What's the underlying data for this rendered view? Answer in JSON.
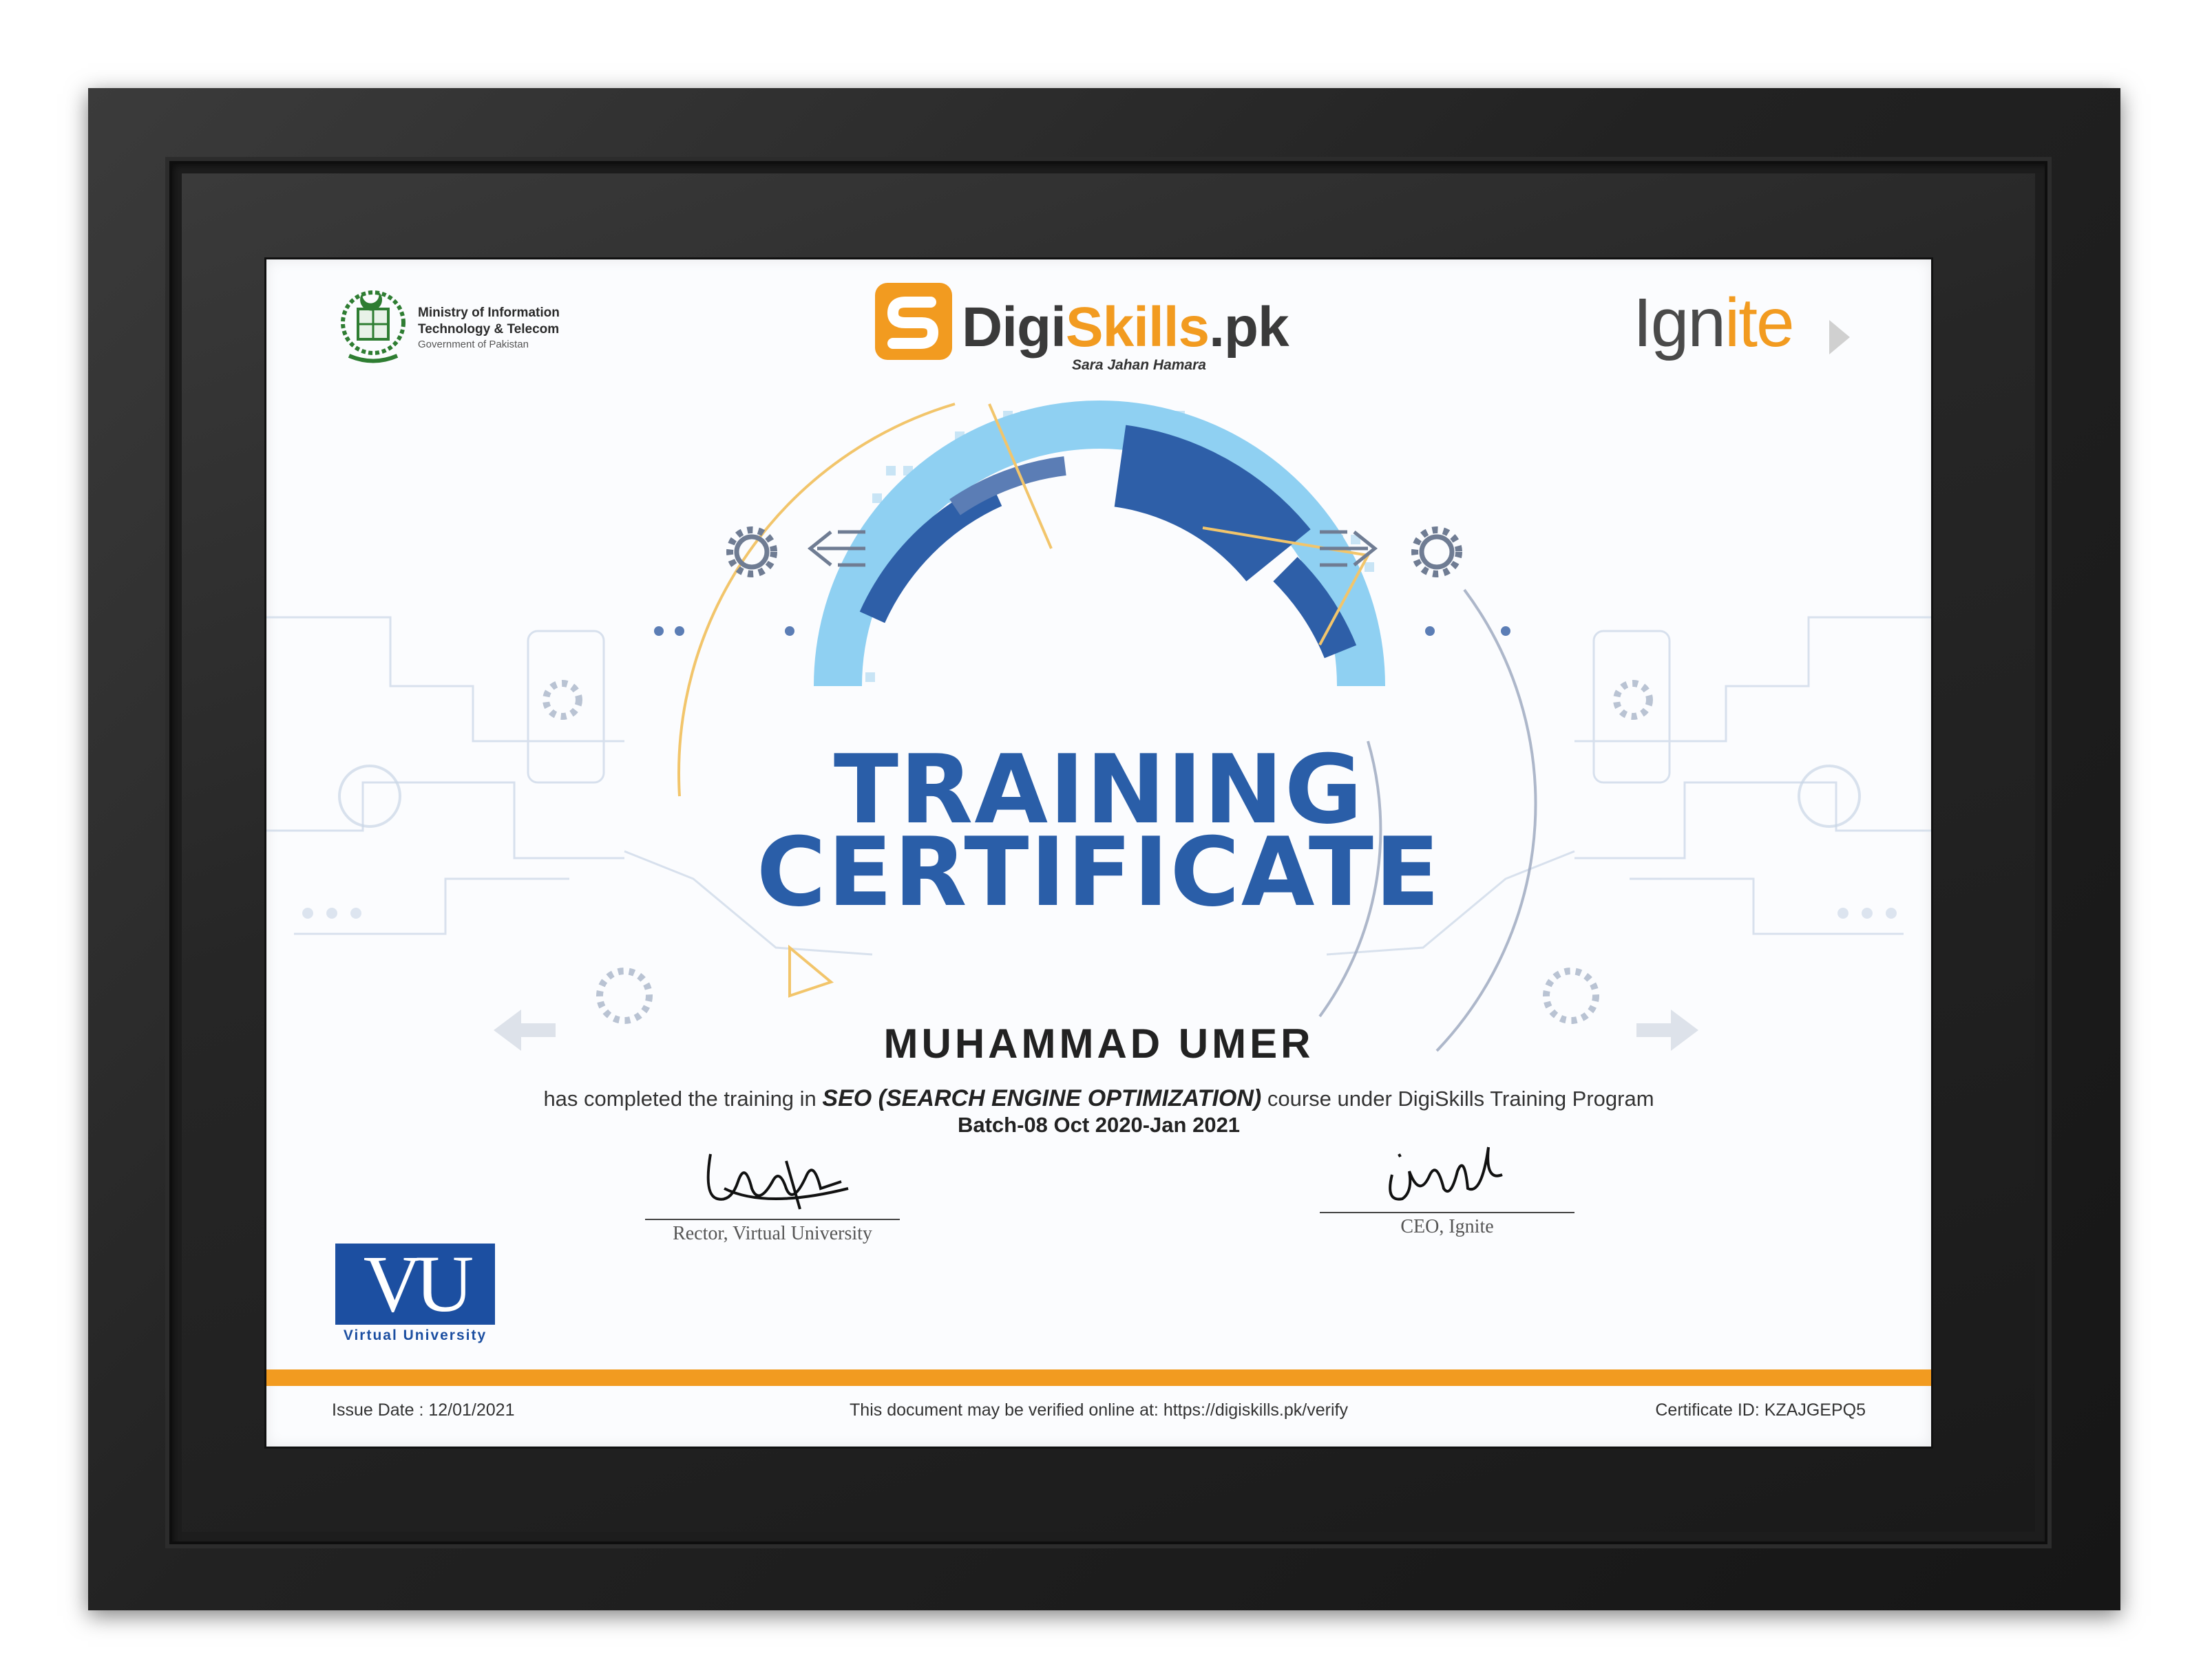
{
  "header": {
    "ministry": {
      "line1": "Ministry of Information",
      "line2": "Technology & Telecom",
      "line3": "Government of Pakistan"
    },
    "digiskills": {
      "word_main": "Digi",
      "word_accent": "Skills",
      "word_suffix": ".pk",
      "tagline": "Sara Jahan Hamara"
    },
    "ignite": {
      "word_main": "Ign",
      "word_accent": "ite"
    }
  },
  "certificate": {
    "title_line1": "TRAINING",
    "title_line2": "CERTIFICATE",
    "recipient": "MUHAMMAD UMER",
    "completed_prefix": "has completed the training in ",
    "course": "SEO (SEARCH ENGINE OPTIMIZATION)",
    "completed_suffix": " course under DigiSkills Training Program",
    "batch": "Batch-08 Oct 2020-Jan 2021"
  },
  "signatures": {
    "left_label": "Rector, Virtual University",
    "right_label": "CEO, Ignite"
  },
  "vu_logo": {
    "letters": "VU",
    "caption": "Virtual University"
  },
  "footer": {
    "issue_date": "Issue Date : 12/01/2021",
    "verify_text": "This document may be verified online at: https://digiskills.pk/verify",
    "certificate_id": "Certificate ID: KZAJGEPQ5"
  },
  "colors": {
    "title_blue": "#2a5ea8",
    "accent_orange": "#f29b20",
    "vu_blue": "#1c4fa1",
    "frame": "#1d1d1d"
  }
}
